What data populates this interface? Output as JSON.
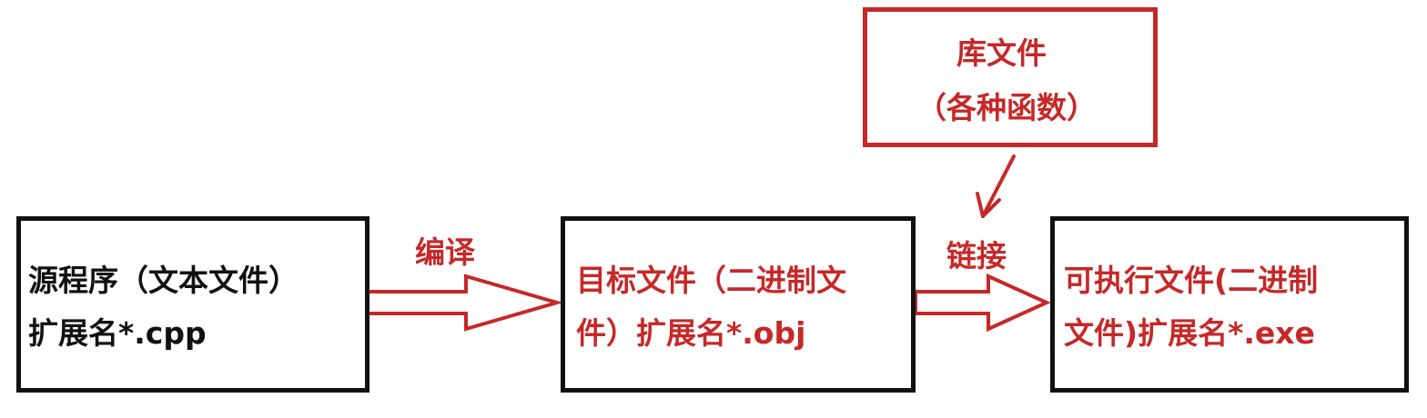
{
  "source_file": {
    "line1": "源程序（文本文件）",
    "line2": "扩展名*.cpp"
  },
  "compile_label": "编译",
  "object_file": {
    "line1": "目标文件（二进制文",
    "line2": "件）扩展名*.obj"
  },
  "link_label": "链接",
  "library_file": {
    "line1": "库文件",
    "line2": "（各种函数）"
  },
  "executable_file": {
    "line1": "可执行文件(二进制",
    "line2": "文件)扩展名*.exe"
  },
  "colors": {
    "red": "#c62828",
    "black": "#111111"
  }
}
